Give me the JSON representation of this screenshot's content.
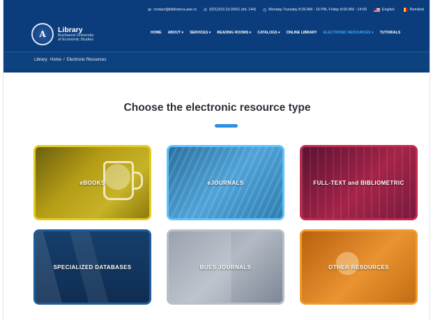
{
  "topbar": {
    "email": "contact@biblioteca.ase.ro",
    "phone": "(021)319.19.00/01 (int. 144)",
    "hours": "Monday-Tuesday 8:30 AM - 16 PM, Friday 8:00 AM - 14:00",
    "lang_en": "English",
    "lang_ro": "Română"
  },
  "logo": {
    "emblem": "A",
    "title": "Library",
    "sub1": "Bucharest University",
    "sub2": "of Economic Studies"
  },
  "nav": {
    "home": "HOME",
    "about": "ABOUT ▾",
    "services": "SERVICES ▾",
    "reading_rooms": "READING ROOMS ▾",
    "catalogs": "CATALOGS ▾",
    "online_library": "ONLINE LIBRARY",
    "electronic_resources": "ELECTRONIC RESOURCES ▾",
    "tutorials": "TUTORIALS"
  },
  "breadcrumb": {
    "prefix": "Library:",
    "home": "Home",
    "sep": "/",
    "current": "Electronic Resources"
  },
  "main": {
    "heading": "Choose the electronic resource type"
  },
  "cards": [
    {
      "label": "eBOOKS"
    },
    {
      "label": "eJOURNALS"
    },
    {
      "label": "FULL-TEXT and BIBLIOMETRIC"
    },
    {
      "label": "SPECIALIZED DATABASES"
    },
    {
      "label": "BUES JOURNALS"
    },
    {
      "label": "OTHER RESOURCES"
    }
  ],
  "colors": {
    "header_bg": "#0b3d7d",
    "accent": "#2d8fe6",
    "active_nav": "#3fa9f5"
  }
}
